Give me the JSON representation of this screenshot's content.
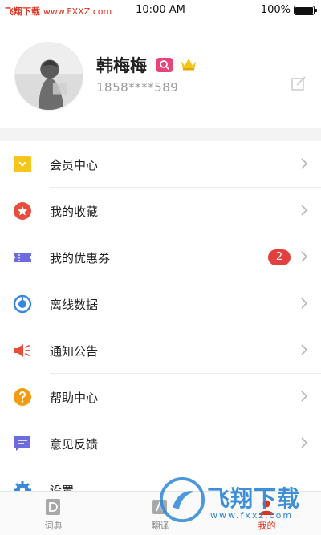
{
  "status_bar": {
    "carrier": "飞翔下载",
    "domain": "www.FXXZ.com",
    "time": "10:00 AM",
    "battery": "100%"
  },
  "profile": {
    "username": "韩梅梅",
    "phone": "1858****589"
  },
  "menu": [
    {
      "label": "会员中心",
      "icon": "vip-icon",
      "color": "#f5c518"
    },
    {
      "label": "我的收藏",
      "icon": "star-icon",
      "color": "#e74c3c"
    },
    {
      "label": "我的优惠券",
      "icon": "coupon-icon",
      "color": "#6c6ce0",
      "badge": "2"
    },
    {
      "label": "离线数据",
      "icon": "download-icon",
      "color": "#3a86d8"
    },
    {
      "label": "通知公告",
      "icon": "megaphone-icon",
      "color": "#e74c3c"
    },
    {
      "label": "帮助中心",
      "icon": "help-icon",
      "color": "#f39c12"
    },
    {
      "label": "意见反馈",
      "icon": "feedback-icon",
      "color": "#6c6ce0"
    },
    {
      "label": "设置",
      "icon": "gear-icon",
      "color": "#3a86d8"
    }
  ],
  "tabs": [
    {
      "label": "词典",
      "icon": "dictionary-icon",
      "active": false
    },
    {
      "label": "翻译",
      "icon": "translate-icon",
      "active": false
    },
    {
      "label": "我的",
      "icon": "user-icon",
      "active": true
    }
  ],
  "watermark": {
    "text": "飞翔下载",
    "url": "www.fxxz.com"
  },
  "colors": {
    "accent": "#e0301e",
    "badge": "#e23f3f",
    "watermark": "#2d86d6"
  }
}
